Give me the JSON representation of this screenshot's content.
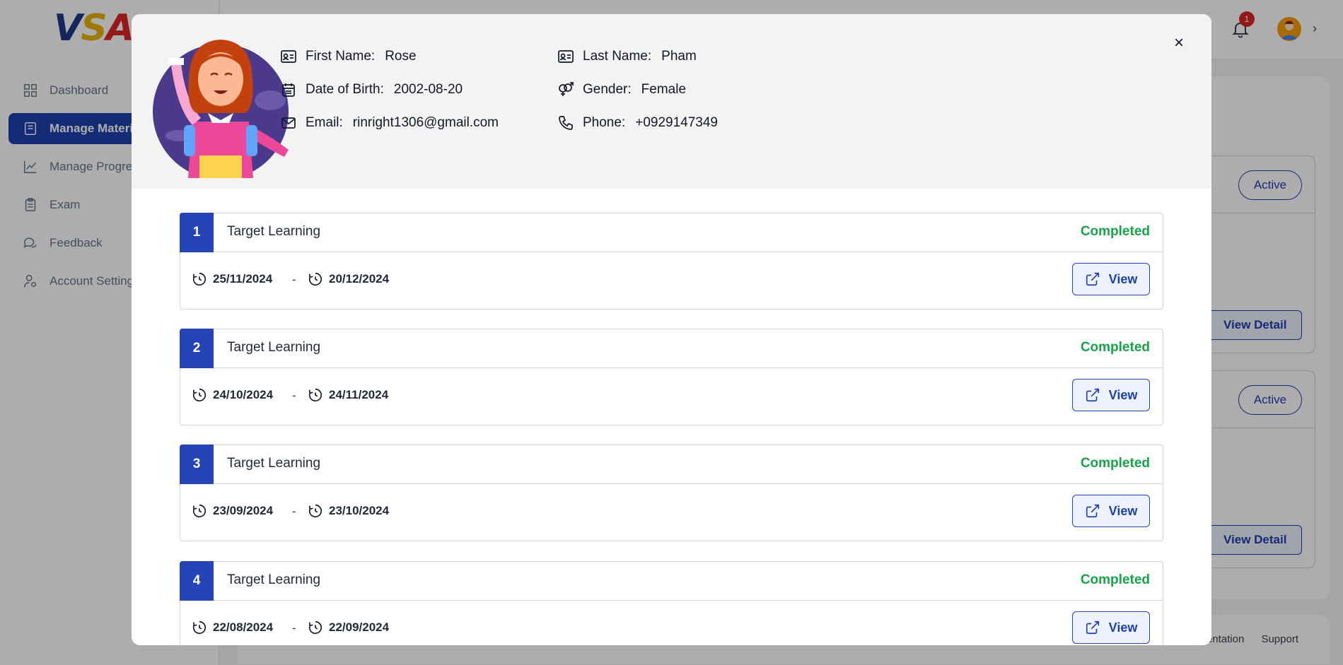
{
  "logo": {
    "part1": "V",
    "part2": "S",
    "part3": "A"
  },
  "sidebar": {
    "items": [
      {
        "label": "Dashboard",
        "icon": "grid-icon",
        "active": false
      },
      {
        "label": "Manage Materi",
        "icon": "book-icon",
        "active": true
      },
      {
        "label": "Manage Progres",
        "icon": "chart-line-icon",
        "active": false
      },
      {
        "label": "Exam",
        "icon": "clipboard-icon",
        "active": false
      },
      {
        "label": "Feedback",
        "icon": "chat-icon",
        "active": false
      },
      {
        "label": "Account Setting",
        "icon": "user-gear-icon",
        "active": false
      }
    ]
  },
  "topbar": {
    "notification_count": "1",
    "chevron": "›"
  },
  "background_cards": [
    {
      "status": "Active",
      "action": "View Detail"
    },
    {
      "status": "Active",
      "action": "View Detail"
    }
  ],
  "footer": {
    "links": [
      "mentation",
      "Support"
    ]
  },
  "profile": {
    "first_name_label": "First Name:",
    "first_name": "Rose",
    "last_name_label": "Last Name:",
    "last_name": "Pham",
    "dob_label": "Date of Birth:",
    "dob": "2002-08-20",
    "gender_label": "Gender:",
    "gender": "Female",
    "email_label": "Email:",
    "email": "rinright1306@gmail.com",
    "phone_label": "Phone:",
    "phone": "+0929147349",
    "close": "×"
  },
  "tasks": [
    {
      "number": "1",
      "title": "Target Learning",
      "status": "Completed",
      "start": "25/11/2024",
      "end": "20/12/2024",
      "separator": "-",
      "action": "View"
    },
    {
      "number": "2",
      "title": "Target Learning",
      "status": "Completed",
      "start": "24/10/2024",
      "end": "24/11/2024",
      "separator": "-",
      "action": "View"
    },
    {
      "number": "3",
      "title": "Target Learning",
      "status": "Completed",
      "start": "23/09/2024",
      "end": "23/10/2024",
      "separator": "-",
      "action": "View"
    },
    {
      "number": "4",
      "title": "Target Learning",
      "status": "Completed",
      "start": "22/08/2024",
      "end": "22/09/2024",
      "separator": "-",
      "action": "View"
    }
  ],
  "colors": {
    "primary": "#2544b7",
    "success": "#16a34a",
    "header_bg": "#f3f3f4"
  }
}
